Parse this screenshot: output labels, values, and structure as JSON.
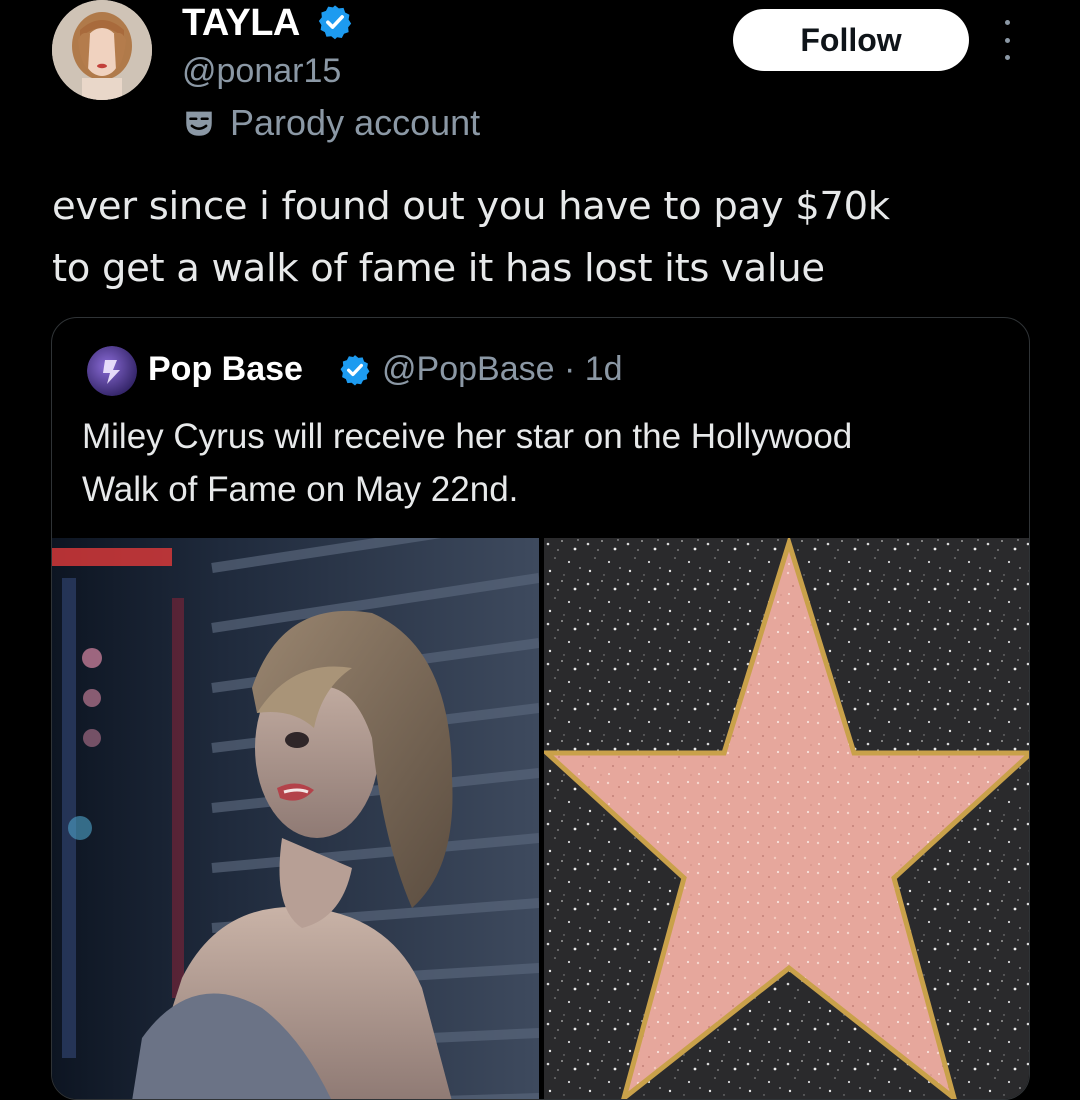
{
  "author": {
    "display_name": "TAYLA",
    "handle": "@ponar15",
    "label": "Parody account",
    "icons": {
      "verified": "verified-badge-icon",
      "parody": "parody-mask-icon",
      "more": "more-options-icon"
    }
  },
  "follow_button": "Follow",
  "tweet": {
    "lines": [
      "ever since i found out you have to pay $70k",
      "to get a walk of fame it has lost its value"
    ]
  },
  "quoted": {
    "name": "Pop Base",
    "meta": "@PopBase · 1d",
    "lines": [
      "Miley Cyrus will receive her star on the Hollywood",
      "Walk of Fame on May 22nd."
    ]
  },
  "colors": {
    "background": "#000000",
    "text": "#e7e9ea",
    "muted": "#8b98a5",
    "verified": "#1d9bf0",
    "star_pink": "#e8a99e",
    "star_gold": "#c9a14a"
  }
}
